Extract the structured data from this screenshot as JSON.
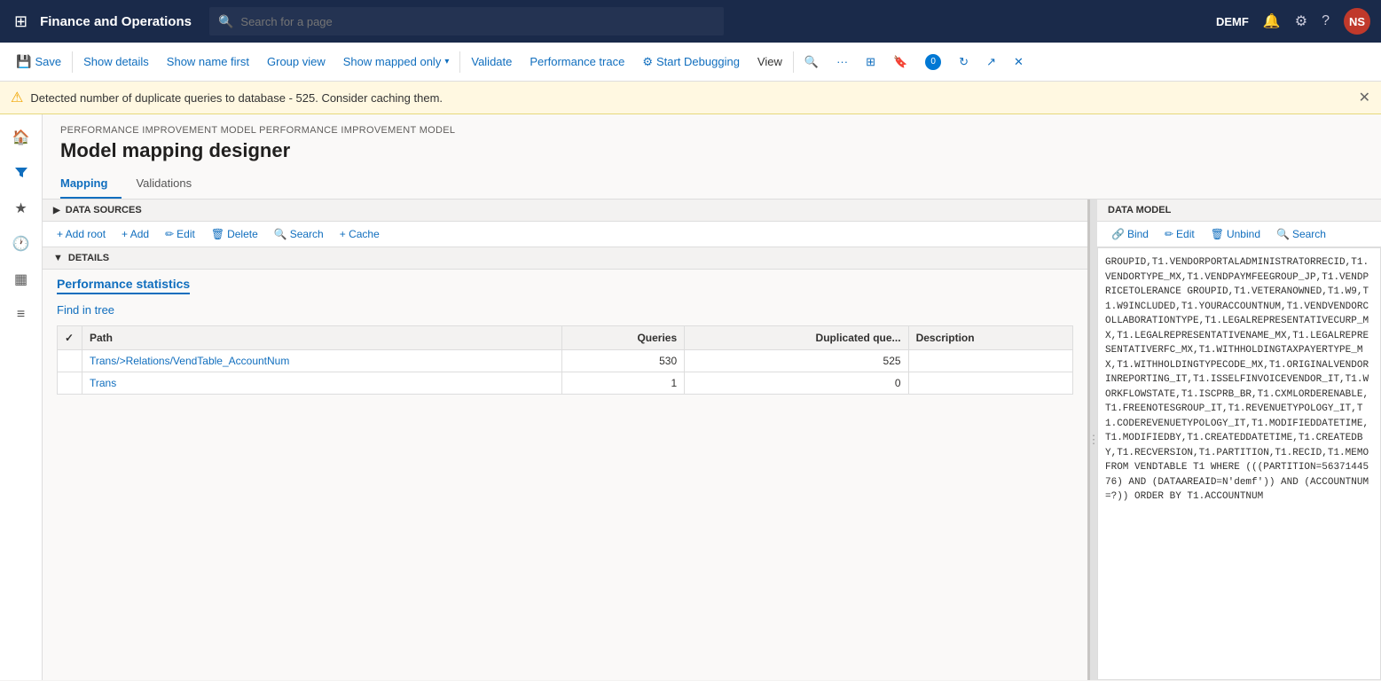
{
  "topNav": {
    "title": "Finance and Operations",
    "searchPlaceholder": "Search for a page",
    "userLabel": "DEMF",
    "userInitials": "NS"
  },
  "toolbar": {
    "saveLabel": "Save",
    "showDetailsLabel": "Show details",
    "showNameFirstLabel": "Show name first",
    "groupViewLabel": "Group view",
    "showMappedOnlyLabel": "Show mapped only",
    "validateLabel": "Validate",
    "performanceTraceLabel": "Performance trace",
    "startDebuggingLabel": "Start Debugging",
    "viewLabel": "View"
  },
  "alert": {
    "message": "Detected number of duplicate queries to database - 525. Consider caching them."
  },
  "breadcrumb": "PERFORMANCE IMPROVEMENT MODEL PERFORMANCE IMPROVEMENT MODEL",
  "pageTitle": "Model mapping designer",
  "tabs": [
    {
      "label": "Mapping",
      "active": true
    },
    {
      "label": "Validations",
      "active": false
    }
  ],
  "dataSourcesSection": {
    "title": "DATA SOURCES"
  },
  "datasourcesToolbar": {
    "addRootLabel": "+ Add root",
    "addLabel": "+ Add",
    "editLabel": "Edit",
    "deleteLabel": "Delete",
    "searchLabel": "Search",
    "cacheLabel": "+ Cache"
  },
  "detailsSection": {
    "title": "DETAILS",
    "performanceStatsLabel": "Performance statistics",
    "findInTreeLabel": "Find in tree"
  },
  "table": {
    "columns": [
      {
        "label": "",
        "key": "check"
      },
      {
        "label": "Path",
        "key": "path"
      },
      {
        "label": "Queries",
        "key": "queries",
        "align": "right"
      },
      {
        "label": "Duplicated que...",
        "key": "duplicated",
        "align": "right"
      },
      {
        "label": "Description",
        "key": "description"
      }
    ],
    "rows": [
      {
        "path": "Trans/>Relations/VendTable_AccountNum",
        "queries": "530",
        "duplicated": "525",
        "description": ""
      },
      {
        "path": "Trans",
        "queries": "1",
        "duplicated": "0",
        "description": ""
      }
    ]
  },
  "dataModel": {
    "title": "DATA MODEL",
    "bindLabel": "Bind",
    "editLabel": "Edit",
    "unbindLabel": "Unbind",
    "searchLabel": "Search"
  },
  "sqlText": "GROUPID,T1.VENDORPORTALADMINISTRATORRECID,T1.VENDORTYPE_MX,T1.VENDPAYMFEEGROUP_JP,T1.VENDPRICETOLERANCE GROUPID,T1.VETERANOWNED,T1.W9,T1.W9INCLUDED,T1.YOURACCOUNTNUM,T1.VENDVENDORCOLLABORATIONTYPE,T1.LEGALREPRESENTATIVECURP_MX,T1.LEGALREPRESENTATIVENAME_MX,T1.LEGALREPRESENTATIVERFC_MX,T1.WITHHOLDINGTAXPAYERTYPE_MX,T1.WITHHOLDINGTYPECODE_MX,T1.ORIGINALVENDORINREPORTING_IT,T1.ISSELFINVOICEVENDOR_IT,T1.WORKFLOWSTATE,T1.ISCPRB_BR,T1.CXMLORDERENABLE,T1.FREENOTESGROUP_IT,T1.REVENUETYPOLOGY_IT,T1.CODEREVENUETYPOLOGY_IT,T1.MODIFIEDDATETIME,T1.MODIFIEDBY,T1.CREATEDDATETIME,T1.CREATEDBY,T1.RECVERSION,T1.PARTITION,T1.RECID,T1.MEMO FROM VENDTABLE T1 WHERE (((PARTITION=5637144576) AND (DATAAREAID=N'demf')) AND (ACCOUNTNUM=?)) ORDER BY T1.ACCOUNTNUM"
}
